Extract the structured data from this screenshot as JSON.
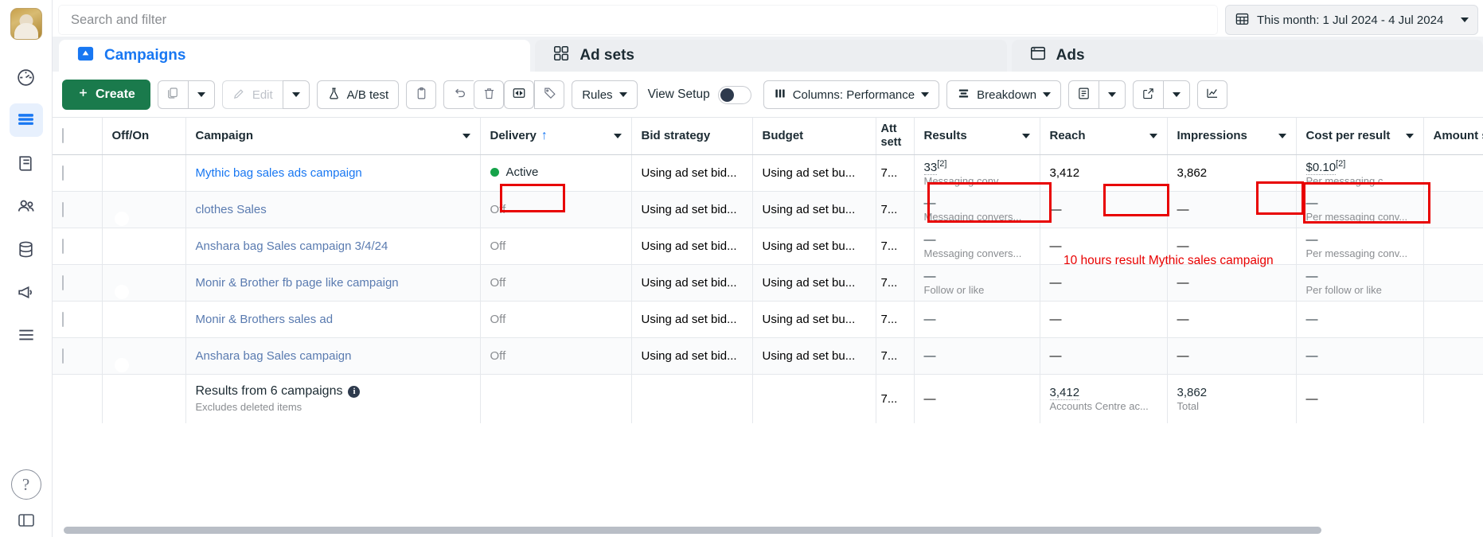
{
  "search": {
    "placeholder": "Search and filter"
  },
  "date_picker": {
    "label": "This month: 1 Jul 2024 - 4 Jul 2024",
    "icon": "calendar-icon"
  },
  "tabs": [
    {
      "label": "Campaigns",
      "icon": "campaign-icon",
      "active": true
    },
    {
      "label": "Ad sets",
      "icon": "adset-icon",
      "active": false
    },
    {
      "label": "Ads",
      "icon": "ads-icon",
      "active": false
    }
  ],
  "toolbar": {
    "create_label": "Create",
    "duplicate_icon": "duplicate-icon",
    "duplicate_caret_icon": "chevron-down-icon",
    "edit_label": "Edit",
    "edit_icon": "pencil-icon",
    "edit_caret_icon": "chevron-down-icon",
    "ab_test_label": "A/B test",
    "ab_test_icon": "flask-icon",
    "copy_icon": "clipboard-icon",
    "undo_icon": "undo-icon",
    "delete_icon": "trash-icon",
    "export_preview_icon": "share-preview-icon",
    "tag_icon": "tag-icon",
    "rules_label": "Rules",
    "rules_caret_icon": "chevron-down-icon",
    "view_setup_label": "View Setup",
    "view_setup_state": "off",
    "columns_label": "Columns: Performance",
    "columns_icon": "columns-icon",
    "breakdown_label": "Breakdown",
    "breakdown_icon": "breakdown-icon",
    "reports_icon": "reports-icon",
    "reports_caret_icon": "chevron-down-icon",
    "export_icon": "export-icon",
    "export_caret_icon": "chevron-down-icon",
    "charts_icon": "charts-icon"
  },
  "table": {
    "columns": [
      {
        "key": "checkbox",
        "label": ""
      },
      {
        "key": "offon",
        "label": "Off/On"
      },
      {
        "key": "campaign",
        "label": "Campaign",
        "caret": true
      },
      {
        "key": "delivery",
        "label": "Delivery",
        "sorted": "asc",
        "caret": true
      },
      {
        "key": "bid",
        "label": "Bid strategy"
      },
      {
        "key": "budget",
        "label": "Budget"
      },
      {
        "key": "attr",
        "label": "Att\nsett"
      },
      {
        "key": "results",
        "label": "Results",
        "caret": true
      },
      {
        "key": "reach",
        "label": "Reach",
        "caret": true
      },
      {
        "key": "impressions",
        "label": "Impressions",
        "caret": true
      },
      {
        "key": "cpr",
        "label": "Cost per result",
        "caret": true
      },
      {
        "key": "spent",
        "label": "Amount spent"
      }
    ],
    "rows": [
      {
        "on": true,
        "campaign": "Mythic bag sales ads campaign",
        "delivery": "Active",
        "delivery_state": "active",
        "bid": "Using ad set bid...",
        "budget": "Using ad set bu...",
        "attr": "7...",
        "results": "33",
        "results_sup": "[2]",
        "results_sub": "Messaging conv...",
        "reach": "3,412",
        "impressions": "3,862",
        "cpr": "$0.10",
        "cpr_sup": "[2]",
        "cpr_sub": "Per messaging c...",
        "spent": ""
      },
      {
        "on": false,
        "campaign": "clothes Sales",
        "delivery": "Off",
        "delivery_state": "off",
        "bid": "Using ad set bid...",
        "budget": "Using ad set bu...",
        "attr": "7...",
        "results": "—",
        "results_sup": "",
        "results_sub": "Messaging convers...",
        "reach": "—",
        "impressions": "—",
        "cpr": "—",
        "cpr_sup": "",
        "cpr_sub": "Per messaging conv...",
        "spent": ""
      },
      {
        "on": false,
        "campaign": "Anshara bag Sales campaign 3/4/24",
        "delivery": "Off",
        "delivery_state": "off",
        "bid": "Using ad set bid...",
        "budget": "Using ad set bu...",
        "attr": "7...",
        "results": "—",
        "results_sup": "",
        "results_sub": "Messaging convers...",
        "reach": "—",
        "impressions": "—",
        "cpr": "—",
        "cpr_sup": "",
        "cpr_sub": "Per messaging conv...",
        "spent": ""
      },
      {
        "on": false,
        "campaign": "Monir & Brother fb page like campaign",
        "delivery": "Off",
        "delivery_state": "off",
        "bid": "Using ad set bid...",
        "budget": "Using ad set bu...",
        "attr": "7...",
        "results": "—",
        "results_sup": "",
        "results_sub": "Follow or like",
        "reach": "—",
        "impressions": "—",
        "cpr": "—",
        "cpr_sup": "",
        "cpr_sub": "Per follow or like",
        "spent": ""
      },
      {
        "on": false,
        "campaign": "Monir & Brothers sales ad",
        "delivery": "Off",
        "delivery_state": "off",
        "bid": "Using ad set bid...",
        "budget": "Using ad set bu...",
        "attr": "7...",
        "results": "—",
        "results_sup": "",
        "results_sub": "",
        "reach": "—",
        "impressions": "—",
        "cpr": "—",
        "cpr_sup": "",
        "cpr_sub": "",
        "spent": ""
      },
      {
        "on": false,
        "campaign": "Anshara bag Sales campaign",
        "delivery": "Off",
        "delivery_state": "off",
        "bid": "Using ad set bid...",
        "budget": "Using ad set bu...",
        "attr": "7...",
        "results": "—",
        "results_sup": "",
        "results_sub": "",
        "reach": "—",
        "impressions": "—",
        "cpr": "—",
        "cpr_sup": "",
        "cpr_sub": "",
        "spent": ""
      }
    ],
    "summary": {
      "title": "Results from 6 campaigns",
      "subtitle": "Excludes deleted items",
      "attr": "7...",
      "results": "—",
      "reach": "3,412",
      "reach_sub": "Accounts Centre ac...",
      "impressions": "3,862",
      "impressions_sub": "Total",
      "cpr": "—",
      "spent": ""
    }
  },
  "annotations": {
    "note_text": "10 hours result Mythic sales campaign",
    "color": "#e80000"
  }
}
